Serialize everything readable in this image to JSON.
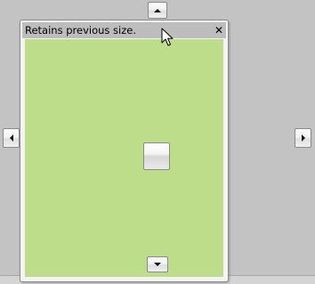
{
  "pane": {
    "title": "Retains previous size.",
    "close_glyph": "✕"
  },
  "colors": {
    "host_background": "#c3c3c3",
    "title_bar": "#bdbdbd",
    "pane_body": "#bedd8a"
  },
  "icons": {
    "dock_top": "arrow-up-icon",
    "dock_left": "arrow-left-icon",
    "dock_right": "arrow-right-icon",
    "dock_bottom": "arrow-down-icon",
    "dock_center": "dock-center-icon",
    "close": "close-icon",
    "cursor": "mouse-pointer-icon"
  }
}
